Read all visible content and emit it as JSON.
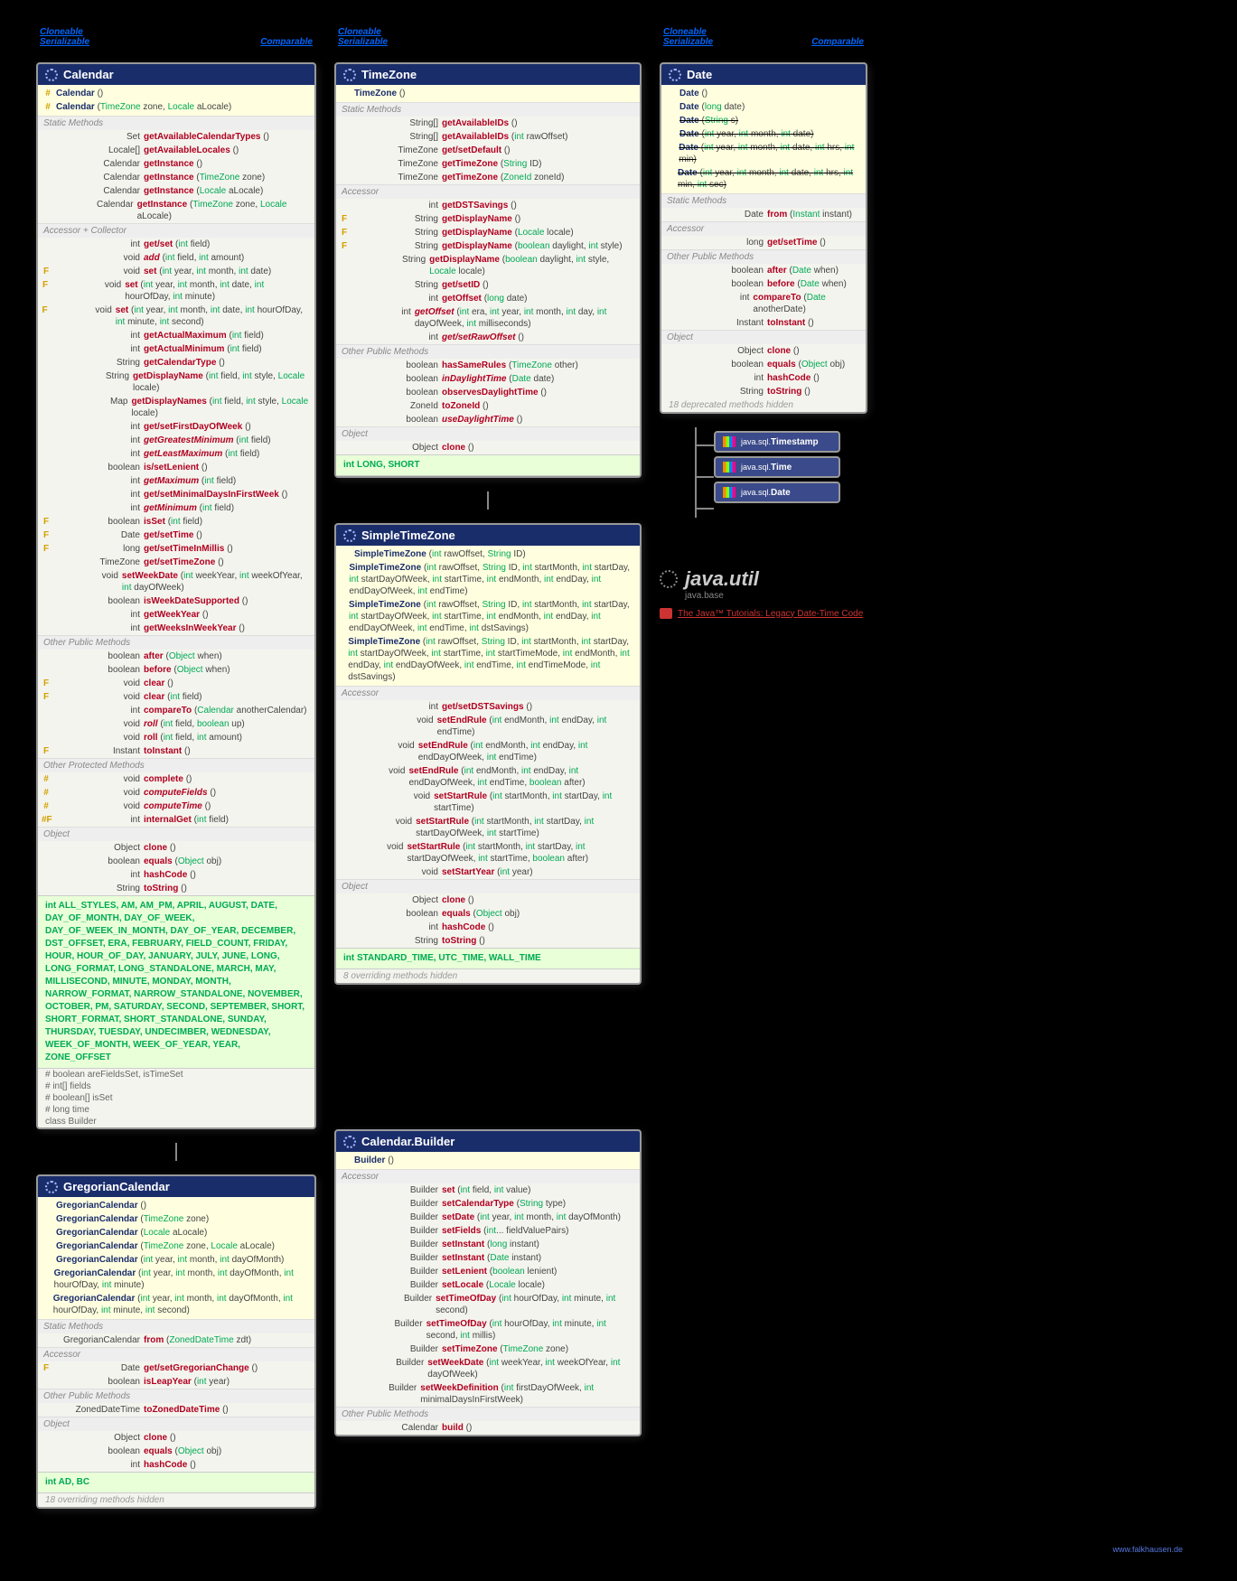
{
  "impl": {
    "cloneable": "Cloneable",
    "serializable": "Serializable",
    "comparable": "Comparable <T>"
  },
  "calendar": {
    "title": "Calendar",
    "ctors": [
      {
        "m": "#",
        "n": "Calendar",
        "p": "()"
      },
      {
        "m": "#",
        "n": "Calendar",
        "p": "(TimeZone zone, Locale aLocale)"
      }
    ],
    "sections": [
      {
        "hdr": "Static Methods",
        "rows": [
          {
            "t": "Set<String>",
            "n": "getAvailableCalendarTypes",
            "p": "()"
          },
          {
            "t": "Locale[]",
            "n": "getAvailableLocales",
            "p": "()"
          },
          {
            "t": "Calendar",
            "n": "getInstance",
            "p": "()"
          },
          {
            "t": "Calendar",
            "n": "getInstance",
            "p": "(TimeZone zone)"
          },
          {
            "t": "Calendar",
            "n": "getInstance",
            "p": "(Locale aLocale)"
          },
          {
            "t": "Calendar",
            "n": "getInstance",
            "p": "(TimeZone zone, Locale aLocale)"
          }
        ]
      },
      {
        "hdr": "Accessor + Collector",
        "rows": [
          {
            "t": "int",
            "n": "get/set",
            "p": "(int field)"
          },
          {
            "t": "void",
            "n": "add",
            "p": "(int field, int amount)",
            "it": true
          },
          {
            "m": "F",
            "t": "void",
            "n": "set",
            "p": "(int year, int month, int date)"
          },
          {
            "m": "F",
            "t": "void",
            "n": "set",
            "p": "(int year, int month, int date, int hourOfDay, int minute)"
          },
          {
            "m": "F",
            "t": "void",
            "n": "set",
            "p": "(int year, int month, int date, int hourOfDay, int minute, int second)"
          },
          {
            "t": "int",
            "n": "getActualMaximum",
            "p": "(int field)"
          },
          {
            "t": "int",
            "n": "getActualMinimum",
            "p": "(int field)"
          },
          {
            "t": "String",
            "n": "getCalendarType",
            "p": "()"
          },
          {
            "t": "String",
            "n": "getDisplayName",
            "p": "(int field, int style, Locale locale)"
          },
          {
            "t": "Map<String,Integer>",
            "n": "getDisplayNames",
            "p": "(int field, int style, Locale locale)"
          },
          {
            "t": "int",
            "n": "get/setFirstDayOfWeek",
            "p": "()"
          },
          {
            "t": "int",
            "n": "getGreatestMinimum",
            "p": "(int field)",
            "it": true
          },
          {
            "t": "int",
            "n": "getLeastMaximum",
            "p": "(int field)",
            "it": true
          },
          {
            "t": "boolean",
            "n": "is/setLenient",
            "p": "()"
          },
          {
            "t": "int",
            "n": "getMaximum",
            "p": "(int field)",
            "it": true
          },
          {
            "t": "int",
            "n": "get/setMinimalDaysInFirstWeek",
            "p": "()"
          },
          {
            "t": "int",
            "n": "getMinimum",
            "p": "(int field)",
            "it": true
          },
          {
            "m": "F",
            "t": "boolean",
            "n": "isSet",
            "p": "(int field)"
          },
          {
            "m": "F",
            "t": "Date",
            "n": "get/setTime",
            "p": "()"
          },
          {
            "m": "F",
            "t": "long",
            "n": "get/setTimeInMillis",
            "p": "()"
          },
          {
            "t": "TimeZone",
            "n": "get/setTimeZone",
            "p": "()"
          },
          {
            "t": "void",
            "n": "setWeekDate",
            "p": "(int weekYear, int weekOfYear, int dayOfWeek)"
          },
          {
            "t": "boolean",
            "n": "isWeekDateSupported",
            "p": "()"
          },
          {
            "t": "int",
            "n": "getWeekYear",
            "p": "()"
          },
          {
            "t": "int",
            "n": "getWeeksInWeekYear",
            "p": "()"
          }
        ]
      },
      {
        "hdr": "Other Public Methods",
        "rows": [
          {
            "t": "boolean",
            "n": "after",
            "p": "(Object when)"
          },
          {
            "t": "boolean",
            "n": "before",
            "p": "(Object when)"
          },
          {
            "m": "F",
            "t": "void",
            "n": "clear",
            "p": "()"
          },
          {
            "m": "F",
            "t": "void",
            "n": "clear",
            "p": "(int field)"
          },
          {
            "t": "int",
            "n": "compareTo",
            "p": "(Calendar anotherCalendar)"
          },
          {
            "t": "void",
            "n": "roll",
            "p": "(int field, boolean up)",
            "it": true
          },
          {
            "t": "void",
            "n": "roll",
            "p": "(int field, int amount)"
          },
          {
            "m": "F",
            "t": "Instant",
            "n": "toInstant",
            "p": "()"
          }
        ]
      },
      {
        "hdr": "Other Protected Methods",
        "rows": [
          {
            "m": "#",
            "t": "void",
            "n": "complete",
            "p": "()"
          },
          {
            "m": "#",
            "t": "void",
            "n": "computeFields",
            "p": "()",
            "it": true
          },
          {
            "m": "#",
            "t": "void",
            "n": "computeTime",
            "p": "()",
            "it": true
          },
          {
            "m": "#F",
            "t": "int",
            "n": "internalGet",
            "p": "(int field)"
          }
        ]
      },
      {
        "hdr": "Object",
        "rows": [
          {
            "t": "Object",
            "n": "clone",
            "p": "()"
          },
          {
            "t": "boolean",
            "n": "equals",
            "p": "(Object obj)"
          },
          {
            "t": "int",
            "n": "hashCode",
            "p": "()"
          },
          {
            "t": "String",
            "n": "toString",
            "p": "()"
          }
        ]
      }
    ],
    "fields": "int ALL_STYLES, AM, AM_PM, APRIL, AUGUST, DATE, DAY_OF_MONTH, DAY_OF_WEEK, DAY_OF_WEEK_IN_MONTH, DAY_OF_YEAR, DECEMBER, DST_OFFSET, ERA, FEBRUARY, FIELD_COUNT, FRIDAY, HOUR, HOUR_OF_DAY, JANUARY, JULY, JUNE, LONG, LONG_FORMAT, LONG_STANDALONE, MARCH, MAY, MILLISECOND, MINUTE, MONDAY, MONTH, NARROW_FORMAT, NARROW_STANDALONE, NOVEMBER, OCTOBER, PM, SATURDAY, SECOND, SEPTEMBER, SHORT, SHORT_FORMAT, SHORT_STANDALONE, SUNDAY, THURSDAY, TUESDAY, UNDECIMBER, WEDNESDAY, WEEK_OF_MONTH, WEEK_OF_YEAR, YEAR, ZONE_OFFSET",
    "minors": [
      "# boolean areFieldsSet, isTimeSet",
      "# int[] fields",
      "# boolean[] isSet",
      "# long time",
      "class Builder"
    ]
  },
  "gregorian": {
    "title": "GregorianCalendar",
    "ctors": [
      {
        "n": "GregorianCalendar",
        "p": "()"
      },
      {
        "n": "GregorianCalendar",
        "p": "(TimeZone zone)"
      },
      {
        "n": "GregorianCalendar",
        "p": "(Locale aLocale)"
      },
      {
        "n": "GregorianCalendar",
        "p": "(TimeZone zone, Locale aLocale)"
      },
      {
        "n": "GregorianCalendar",
        "p": "(int year, int month, int dayOfMonth)"
      },
      {
        "n": "GregorianCalendar",
        "p": "(int year, int month, int dayOfMonth, int hourOfDay, int minute)"
      },
      {
        "n": "GregorianCalendar",
        "p": "(int year, int month, int dayOfMonth, int hourOfDay, int minute, int second)"
      }
    ],
    "sections": [
      {
        "hdr": "Static Methods",
        "rows": [
          {
            "t": "GregorianCalendar",
            "n": "from",
            "p": "(ZonedDateTime zdt)"
          }
        ]
      },
      {
        "hdr": "Accessor",
        "rows": [
          {
            "m": "F",
            "t": "Date",
            "n": "get/setGregorianChange",
            "p": "()"
          },
          {
            "t": "boolean",
            "n": "isLeapYear",
            "p": "(int year)"
          }
        ]
      },
      {
        "hdr": "Other Public Methods",
        "rows": [
          {
            "t": "ZonedDateTime",
            "n": "toZonedDateTime",
            "p": "()"
          }
        ]
      },
      {
        "hdr": "Object",
        "rows": [
          {
            "t": "Object",
            "n": "clone",
            "p": "()"
          },
          {
            "t": "boolean",
            "n": "equals",
            "p": "(Object obj)"
          },
          {
            "t": "int",
            "n": "hashCode",
            "p": "()"
          }
        ]
      }
    ],
    "fields": "int AD, BC",
    "hidden": "18 overriding methods hidden"
  },
  "timezone": {
    "title": "TimeZone",
    "ctors": [
      {
        "n": "TimeZone",
        "p": "()"
      }
    ],
    "sections": [
      {
        "hdr": "Static Methods",
        "rows": [
          {
            "t": "String[]",
            "n": "getAvailableIDs",
            "p": "()"
          },
          {
            "t": "String[]",
            "n": "getAvailableIDs",
            "p": "(int rawOffset)"
          },
          {
            "t": "TimeZone",
            "n": "get/setDefault",
            "p": "()"
          },
          {
            "t": "TimeZone",
            "n": "getTimeZone",
            "p": "(String ID)"
          },
          {
            "t": "TimeZone",
            "n": "getTimeZone",
            "p": "(ZoneId zoneId)"
          }
        ]
      },
      {
        "hdr": "Accessor",
        "rows": [
          {
            "t": "int",
            "n": "getDSTSavings",
            "p": "()"
          },
          {
            "m": "F",
            "t": "String",
            "n": "getDisplayName",
            "p": "()"
          },
          {
            "m": "F",
            "t": "String",
            "n": "getDisplayName",
            "p": "(Locale locale)"
          },
          {
            "m": "F",
            "t": "String",
            "n": "getDisplayName",
            "p": "(boolean daylight, int style)"
          },
          {
            "t": "String",
            "n": "getDisplayName",
            "p": "(boolean daylight, int style, Locale locale)"
          },
          {
            "t": "String",
            "n": "get/setID",
            "p": "()"
          },
          {
            "t": "int",
            "n": "getOffset",
            "p": "(long date)"
          },
          {
            "t": "int",
            "n": "getOffset",
            "p": "(int era, int year, int month, int day, int dayOfWeek, int milliseconds)",
            "it": true
          },
          {
            "t": "int",
            "n": "get/setRawOffset",
            "p": "()",
            "it": true
          }
        ]
      },
      {
        "hdr": "Other Public Methods",
        "rows": [
          {
            "t": "boolean",
            "n": "hasSameRules",
            "p": "(TimeZone other)"
          },
          {
            "t": "boolean",
            "n": "inDaylightTime",
            "p": "(Date date)",
            "it": true
          },
          {
            "t": "boolean",
            "n": "observesDaylightTime",
            "p": "()"
          },
          {
            "t": "ZoneId",
            "n": "toZoneId",
            "p": "()"
          },
          {
            "t": "boolean",
            "n": "useDaylightTime",
            "p": "()",
            "it": true
          }
        ]
      },
      {
        "hdr": "Object",
        "rows": [
          {
            "t": "Object",
            "n": "clone",
            "p": "()"
          }
        ]
      }
    ],
    "fields": "int LONG, SHORT"
  },
  "simpletz": {
    "title": "SimpleTimeZone",
    "ctors": [
      {
        "n": "SimpleTimeZone",
        "p": "(int rawOffset, String ID)"
      },
      {
        "n": "SimpleTimeZone",
        "p": "(int rawOffset, String ID, int startMonth, int startDay, int startDayOfWeek, int startTime, int endMonth, int endDay, int endDayOfWeek, int endTime)"
      },
      {
        "n": "SimpleTimeZone",
        "p": "(int rawOffset, String ID, int startMonth, int startDay, int startDayOfWeek, int startTime, int endMonth, int endDay, int endDayOfWeek, int endTime, int dstSavings)"
      },
      {
        "n": "SimpleTimeZone",
        "p": "(int rawOffset, String ID, int startMonth, int startDay, int startDayOfWeek, int startTime, int startTimeMode, int endMonth, int endDay, int endDayOfWeek, int endTime, int endTimeMode, int dstSavings)"
      }
    ],
    "sections": [
      {
        "hdr": "Accessor",
        "rows": [
          {
            "t": "int",
            "n": "get/setDSTSavings",
            "p": "()"
          },
          {
            "t": "void",
            "n": "setEndRule",
            "p": "(int endMonth, int endDay, int endTime)"
          },
          {
            "t": "void",
            "n": "setEndRule",
            "p": "(int endMonth, int endDay, int endDayOfWeek, int endTime)"
          },
          {
            "t": "void",
            "n": "setEndRule",
            "p": "(int endMonth, int endDay, int endDayOfWeek, int endTime, boolean after)"
          },
          {
            "t": "void",
            "n": "setStartRule",
            "p": "(int startMonth, int startDay, int startTime)"
          },
          {
            "t": "void",
            "n": "setStartRule",
            "p": "(int startMonth, int startDay, int startDayOfWeek, int startTime)"
          },
          {
            "t": "void",
            "n": "setStartRule",
            "p": "(int startMonth, int startDay, int startDayOfWeek, int startTime, boolean after)"
          },
          {
            "t": "void",
            "n": "setStartYear",
            "p": "(int year)"
          }
        ]
      },
      {
        "hdr": "Object",
        "rows": [
          {
            "t": "Object",
            "n": "clone",
            "p": "()"
          },
          {
            "t": "boolean",
            "n": "equals",
            "p": "(Object obj)"
          },
          {
            "t": "int",
            "n": "hashCode",
            "p": "()"
          },
          {
            "t": "String",
            "n": "toString",
            "p": "()"
          }
        ]
      }
    ],
    "fields": "int STANDARD_TIME, UTC_TIME, WALL_TIME",
    "hidden": "8 overriding methods hidden"
  },
  "builder": {
    "title": "Calendar.Builder",
    "ctors": [
      {
        "n": "Builder",
        "p": "()"
      }
    ],
    "sections": [
      {
        "hdr": "Accessor",
        "rows": [
          {
            "t": "Builder",
            "n": "set",
            "p": "(int field, int value)"
          },
          {
            "t": "Builder",
            "n": "setCalendarType",
            "p": "(String type)"
          },
          {
            "t": "Builder",
            "n": "setDate",
            "p": "(int year, int month, int dayOfMonth)"
          },
          {
            "t": "Builder",
            "n": "setFields",
            "p": "(int... fieldValuePairs)"
          },
          {
            "t": "Builder",
            "n": "setInstant",
            "p": "(long instant)"
          },
          {
            "t": "Builder",
            "n": "setInstant",
            "p": "(Date instant)"
          },
          {
            "t": "Builder",
            "n": "setLenient",
            "p": "(boolean lenient)"
          },
          {
            "t": "Builder",
            "n": "setLocale",
            "p": "(Locale locale)"
          },
          {
            "t": "Builder",
            "n": "setTimeOfDay",
            "p": "(int hourOfDay, int minute, int second)"
          },
          {
            "t": "Builder",
            "n": "setTimeOfDay",
            "p": "(int hourOfDay, int minute, int second, int millis)"
          },
          {
            "t": "Builder",
            "n": "setTimeZone",
            "p": "(TimeZone zone)"
          },
          {
            "t": "Builder",
            "n": "setWeekDate",
            "p": "(int weekYear, int weekOfYear, int dayOfWeek)"
          },
          {
            "t": "Builder",
            "n": "setWeekDefinition",
            "p": "(int firstDayOfWeek, int minimalDaysInFirstWeek)"
          }
        ]
      },
      {
        "hdr": "Other Public Methods",
        "rows": [
          {
            "t": "Calendar",
            "n": "build",
            "p": "()"
          }
        ]
      }
    ]
  },
  "date": {
    "title": "Date",
    "ctors": [
      {
        "n": "Date",
        "p": "()"
      },
      {
        "n": "Date",
        "p": "(long date)"
      },
      {
        "n": "Date",
        "p": "(String s)",
        "dep": true
      },
      {
        "n": "Date",
        "p": "(int year, int month, int date)",
        "dep": true
      },
      {
        "n": "Date",
        "p": "(int year, int month, int date, int hrs, int min)",
        "dep": true
      },
      {
        "n": "Date",
        "p": "(int year, int month, int date, int hrs, int min, int sec)",
        "dep": true
      }
    ],
    "sections": [
      {
        "hdr": "Static Methods",
        "rows": [
          {
            "t": "Date",
            "n": "from",
            "p": "(Instant instant)"
          }
        ]
      },
      {
        "hdr": "Accessor",
        "rows": [
          {
            "t": "long",
            "n": "get/setTime",
            "p": "()"
          }
        ]
      },
      {
        "hdr": "Other Public Methods",
        "rows": [
          {
            "t": "boolean",
            "n": "after",
            "p": "(Date when)"
          },
          {
            "t": "boolean",
            "n": "before",
            "p": "(Date when)"
          },
          {
            "t": "int",
            "n": "compareTo",
            "p": "(Date anotherDate)"
          },
          {
            "t": "Instant",
            "n": "toInstant",
            "p": "()"
          }
        ]
      },
      {
        "hdr": "Object",
        "rows": [
          {
            "t": "Object",
            "n": "clone",
            "p": "()"
          },
          {
            "t": "boolean",
            "n": "equals",
            "p": "(Object obj)"
          },
          {
            "t": "int",
            "n": "hashCode",
            "p": "()"
          },
          {
            "t": "String",
            "n": "toString",
            "p": "()"
          }
        ]
      }
    ],
    "hidden": "18 deprecated methods hidden",
    "subs": [
      "java.sql.Timestamp",
      "java.sql.Time",
      "java.sql.Date"
    ]
  },
  "pkg": {
    "name": "java.util",
    "mod": "java.base"
  },
  "tutorial": "The Java™ Tutorials: Legacy Date-Time Code",
  "watermark": "www.falkhausen.de"
}
